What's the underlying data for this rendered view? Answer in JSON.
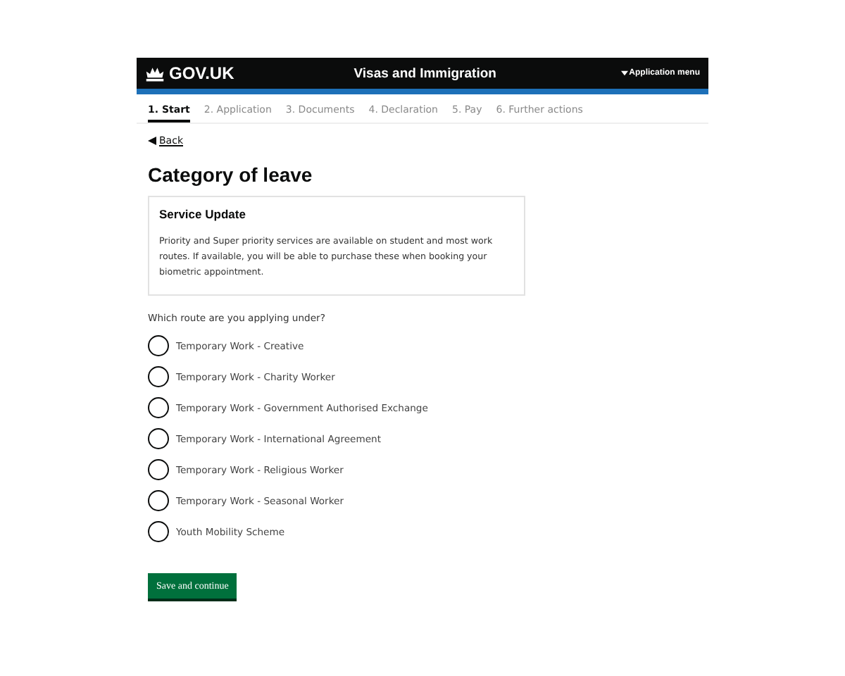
{
  "header": {
    "logo": "GOV.UK",
    "service": "Visas and Immigration",
    "menu": "Application menu"
  },
  "steps": [
    {
      "label": "1. Start",
      "selected": true
    },
    {
      "label": "2. Application",
      "selected": false
    },
    {
      "label": "3. Documents",
      "selected": false
    },
    {
      "label": "4. Declaration",
      "selected": false
    },
    {
      "label": "5. Pay",
      "selected": false
    },
    {
      "label": "6. Further actions",
      "selected": false
    }
  ],
  "back": "Back",
  "title": "Category of leave",
  "notice": {
    "heading": "Service Update",
    "body": "Priority and Super priority services are available on student and most work routes. If available, you will be able to purchase these when booking your biometric appointment."
  },
  "question": "Which route are you applying under?",
  "options": [
    {
      "label": "Temporary Work - Creative",
      "selected": false
    },
    {
      "label": "Temporary Work - Charity Worker",
      "selected": false
    },
    {
      "label": "Temporary Work - Government Authorised Exchange",
      "selected": false
    },
    {
      "label": "Temporary Work - International Agreement",
      "selected": false
    },
    {
      "label": "Temporary Work - Religious Worker",
      "selected": false
    },
    {
      "label": "Temporary Work - Seasonal Worker",
      "selected": false
    },
    {
      "label": "Youth Mobility Scheme",
      "selected": false
    }
  ],
  "button": "Save and continue"
}
